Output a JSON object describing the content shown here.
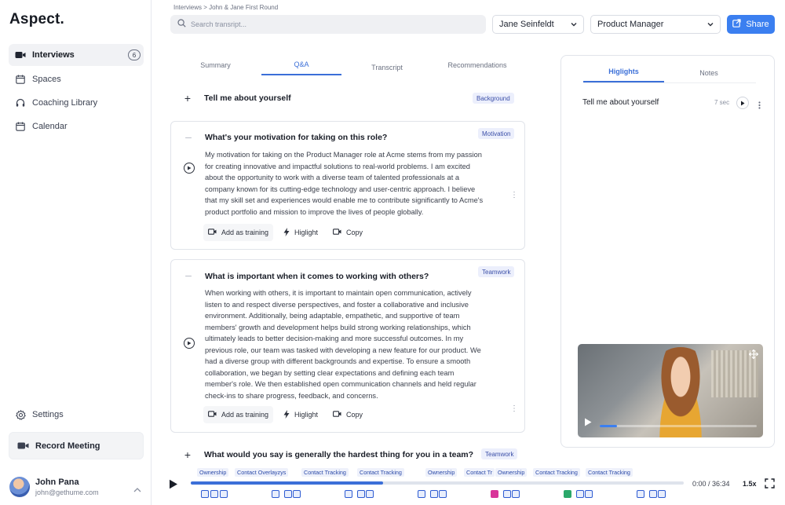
{
  "app": {
    "logo": "Aspect."
  },
  "sidebar": {
    "items": [
      {
        "label": "Interviews",
        "badge": "6",
        "icon": "video-camera-icon",
        "active": true
      },
      {
        "label": "Spaces",
        "icon": "calendar-icon"
      },
      {
        "label": "Coaching Library",
        "icon": "headphones-icon"
      },
      {
        "label": "Calendar",
        "icon": "calendar-icon"
      }
    ],
    "settings_label": "Settings",
    "record_label": "Record Meeting",
    "user": {
      "name": "John Pana",
      "email": "john@gethume.com"
    }
  },
  "header": {
    "breadcrumb": "Interviews > John & Jane First Round",
    "search_placeholder": "Search transript...",
    "interviewer_select": "Jane Seinfeldt",
    "role_select": "Product Manager",
    "share_label": "Share"
  },
  "tabs": [
    "Summary",
    "Q&A",
    "Transcript",
    "Recommendations"
  ],
  "qa": [
    {
      "question": "Tell me about yourself",
      "tag": "Background",
      "expanded": false
    },
    {
      "question": "What's your motivation for taking on this role?",
      "tag": "Motivation",
      "expanded": true,
      "answer_lines": [
        "My motivation for taking on the Product Manager role at Acme stems from my passion",
        "for creating innovative and impactful solutions to real-world problems. I am excited",
        "about the opportunity to work with a diverse team of talented professionals at a",
        "company known for its cutting-edge technology and user-centric approach. I believe",
        "that my skill set and experiences would enable me to contribute significantly to Acme's",
        "product portfolio and mission to improve the lives of people globally."
      ]
    },
    {
      "question": "What is important when it comes to working with others?",
      "tag": "Teamwork",
      "expanded": true,
      "answer_lines": [
        "When working with others, it is important to maintain open communication, actively",
        "listen to and respect diverse perspectives, and foster a collaborative and inclusive",
        "environment. Additionally, being adaptable, empathetic, and supportive of team",
        "members' growth and development helps build strong working relationships, which",
        "ultimately leads to better decision-making and more successful outcomes. In my",
        "previous role, our team was tasked with developing a new feature for our product. We",
        "had a diverse group with different backgrounds and expertise. To ensure a smooth",
        "collaboration, we began by setting clear expectations and defining each team",
        "member's role. We then established open communication channels and held regular",
        "check-ins to share progress, feedback, and concerns."
      ]
    },
    {
      "question": "What would you say is generally the hardest thing for you in a team?",
      "tag": "Teamwork",
      "expanded": false
    }
  ],
  "actions": {
    "add_training": "Add as training",
    "highlight": "Higlight",
    "copy": "Copy"
  },
  "panel": {
    "tabs": [
      "Higlights",
      "Notes"
    ],
    "highlight": {
      "text": "Tell me about yourself",
      "duration": "7 sec"
    }
  },
  "timeline": {
    "labels": [
      "Ownership",
      "Contact Overlayzys",
      "Contact Tracking",
      "Contact Tracking",
      "Ownership",
      "Contact Tr",
      "Ownership",
      "Contact Tracking",
      "Contact Tracking"
    ],
    "progress": 0.39,
    "time": "0:00 / 36:34",
    "speed": "1.5x"
  }
}
